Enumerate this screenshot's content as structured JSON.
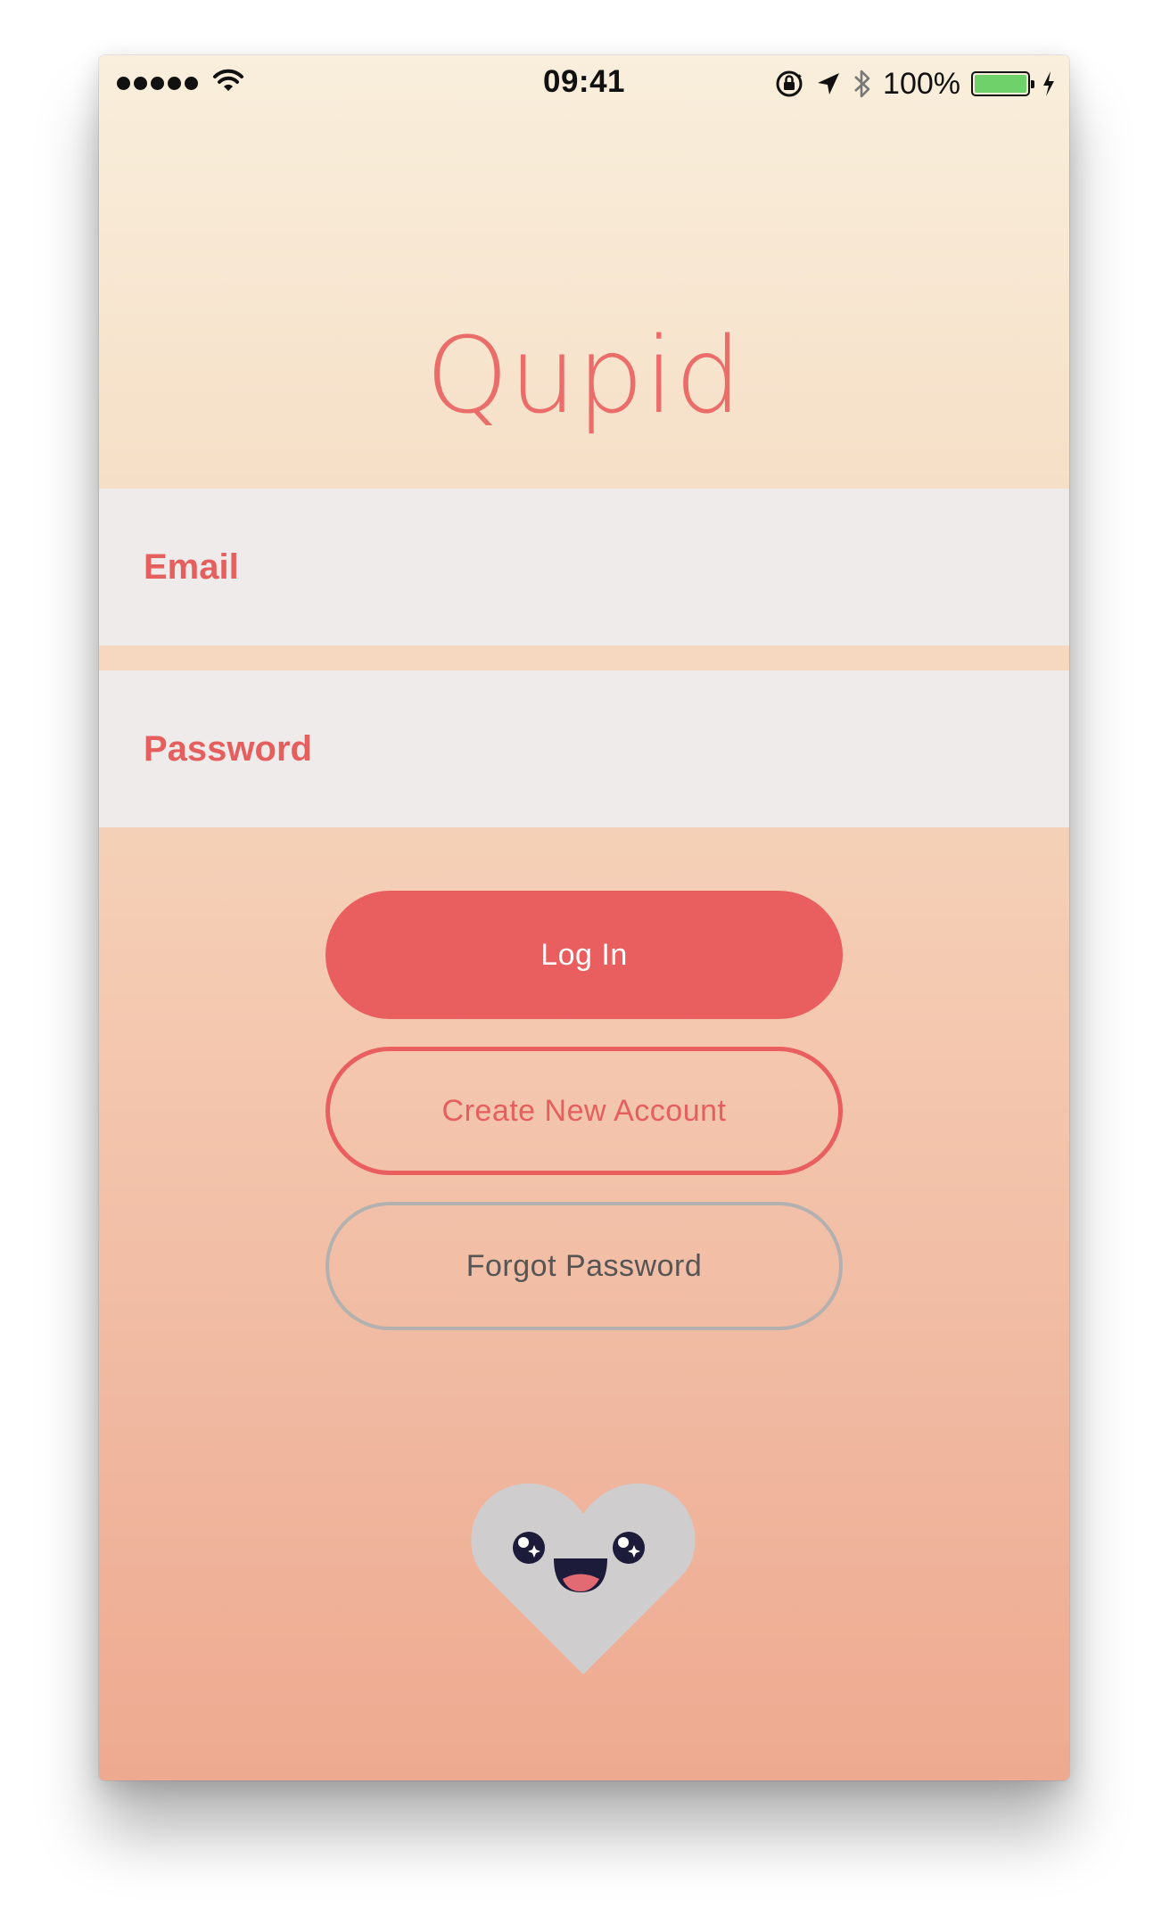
{
  "status_bar": {
    "time": "09:41",
    "battery_percent": "100%",
    "battery_level": 1.0,
    "battery_color": "#6ed16a",
    "icons": [
      "signal-dots-icon",
      "wifi-icon",
      "orientation-lock-icon",
      "location-arrow-icon",
      "bluetooth-icon",
      "battery-icon",
      "charging-bolt-icon"
    ]
  },
  "app": {
    "title": "Qupid",
    "accent_color": "#e95f5f"
  },
  "form": {
    "email_placeholder": "Email",
    "email_value": "",
    "password_placeholder": "Password",
    "password_value": ""
  },
  "buttons": {
    "login_label": "Log In",
    "create_account_label": "Create New Account",
    "forgot_password_label": "Forgot Password"
  },
  "mascot": {
    "icon": "heart-mascot-icon"
  }
}
